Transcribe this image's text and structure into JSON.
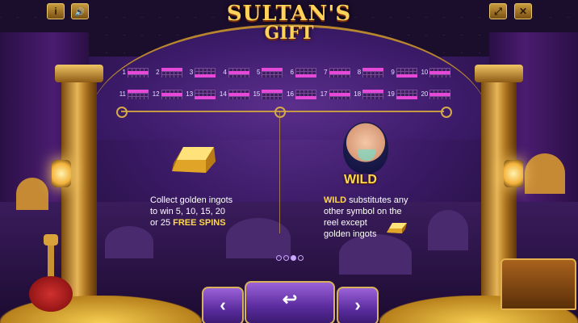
{
  "top_bar": {
    "info_icon": "i",
    "sound_icon": "🔊",
    "fullscreen_icon": "⤢",
    "close_icon": "✕"
  },
  "logo": {
    "line1": "SULTAN'S",
    "line2": "GIFT"
  },
  "paylines": {
    "row1": [
      "1",
      "2",
      "3",
      "4",
      "5",
      "6",
      "7",
      "8",
      "9",
      "10"
    ],
    "row2": [
      "11",
      "12",
      "13",
      "14",
      "15",
      "16",
      "17",
      "18",
      "19",
      "20"
    ]
  },
  "left_panel": {
    "line1": "Collect golden ingots",
    "line2": "to win 5,  10,  15,  20",
    "line3_prefix": "or  25  ",
    "line3_highlight": "FREE SPINS"
  },
  "right_panel": {
    "wild_label": "WILD",
    "line1_highlight": "WILD",
    "line1_rest": "  substitutes any",
    "line2": "other symbol on the",
    "line3": "reel except",
    "line4": "golden ingots"
  },
  "pagination": {
    "total": 4,
    "active": 3
  },
  "nav": {
    "prev": "‹",
    "back": "↩",
    "next": "›"
  },
  "colors": {
    "gold": "#ffd84a",
    "payline_mark": "#e648d8",
    "button_purple": "#5a2c9e"
  }
}
